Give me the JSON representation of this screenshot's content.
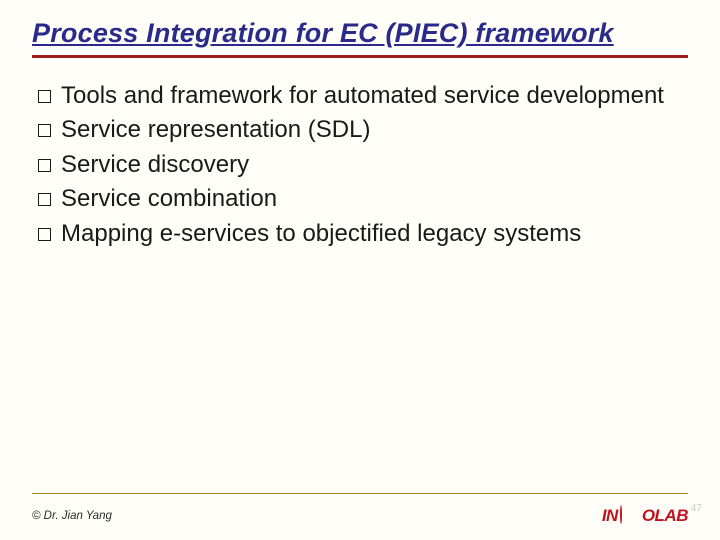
{
  "title": "Process Integration for EC (PIEC) framework",
  "bullets": [
    "Tools and framework for automated service development",
    "Service representation (SDL)",
    "Service discovery",
    "Service combination",
    "Mapping e-services to objectified legacy systems"
  ],
  "footer": {
    "copyright": "© Dr. Jian Yang",
    "logo_in": "IN",
    "logo_olab": "OLAB",
    "page": "47"
  }
}
